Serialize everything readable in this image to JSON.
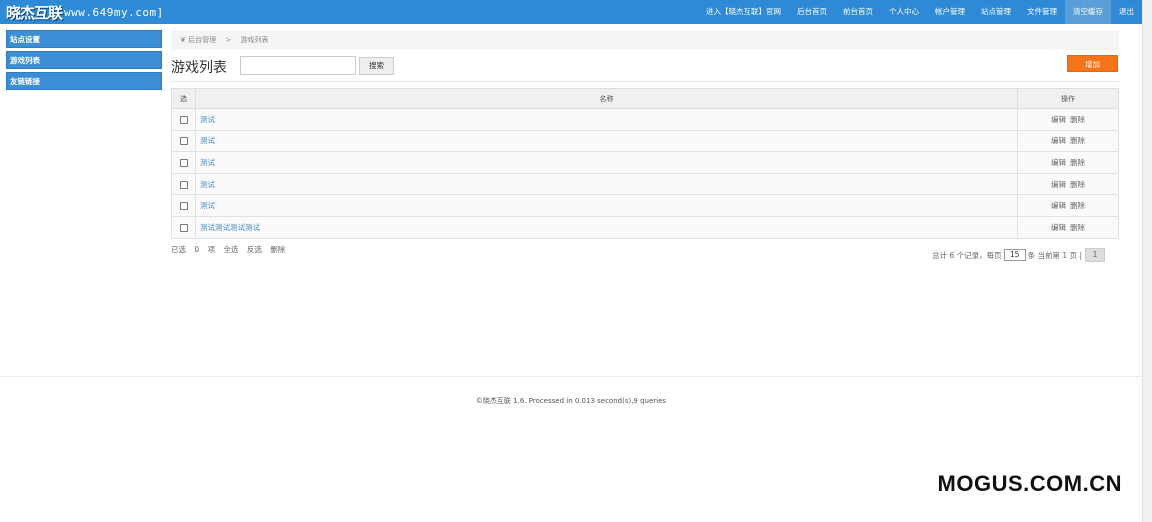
{
  "logo": {
    "main": "晓杰互联",
    "url": "www.649my.com]"
  },
  "nav": [
    {
      "label": "进入【晓杰互联】官网",
      "active": false
    },
    {
      "label": "后台首页",
      "active": false
    },
    {
      "label": "前台首页",
      "active": false
    },
    {
      "label": "个人中心",
      "active": false
    },
    {
      "label": "帐户管理",
      "active": false
    },
    {
      "label": "站点管理",
      "active": false
    },
    {
      "label": "文件管理",
      "active": false
    },
    {
      "label": "清空缓存",
      "active": true
    },
    {
      "label": "退出",
      "active": false
    }
  ],
  "sidebar": {
    "items": [
      {
        "label": "站点设置"
      },
      {
        "label": "游戏列表"
      },
      {
        "label": "友链链接"
      }
    ]
  },
  "breadcrumb": {
    "home": "后台管理",
    "sep": ">",
    "current": "游戏列表"
  },
  "page": {
    "title": "游戏列表",
    "search_value": "",
    "search_button": "搜索",
    "add_button": "增加"
  },
  "table": {
    "headers": {
      "select": "选",
      "name": "名称",
      "ops": "操作"
    },
    "rows": [
      {
        "name": "测试",
        "edit": "编辑",
        "delete": "删除"
      },
      {
        "name": "测试",
        "edit": "编辑",
        "delete": "删除"
      },
      {
        "name": "测试",
        "edit": "编辑",
        "delete": "删除"
      },
      {
        "name": "测试",
        "edit": "编辑",
        "delete": "删除"
      },
      {
        "name": "测试",
        "edit": "编辑",
        "delete": "删除"
      },
      {
        "name": "测试测试测试测试",
        "edit": "编辑",
        "delete": "删除"
      }
    ]
  },
  "bulk": {
    "selected_label": "已选",
    "selected_count": "0",
    "unit": "项",
    "select_all": "全选",
    "invert": "反选",
    "delete": "删除"
  },
  "pager": {
    "total_text": "总计 6 个记录，每页",
    "per_page": "15",
    "current_text": "条 当前第 1 页 |",
    "page": "1"
  },
  "footer": {
    "text": "©晓杰互联 1.6. Processed in 0.013 second(s),9 queries"
  },
  "watermark": "MOGUS.COM.CN",
  "colors": {
    "topbar": "#2e8ad6",
    "sidebar": "#3b8ed3",
    "add_button": "#f57418",
    "link": "#4a89c6"
  }
}
